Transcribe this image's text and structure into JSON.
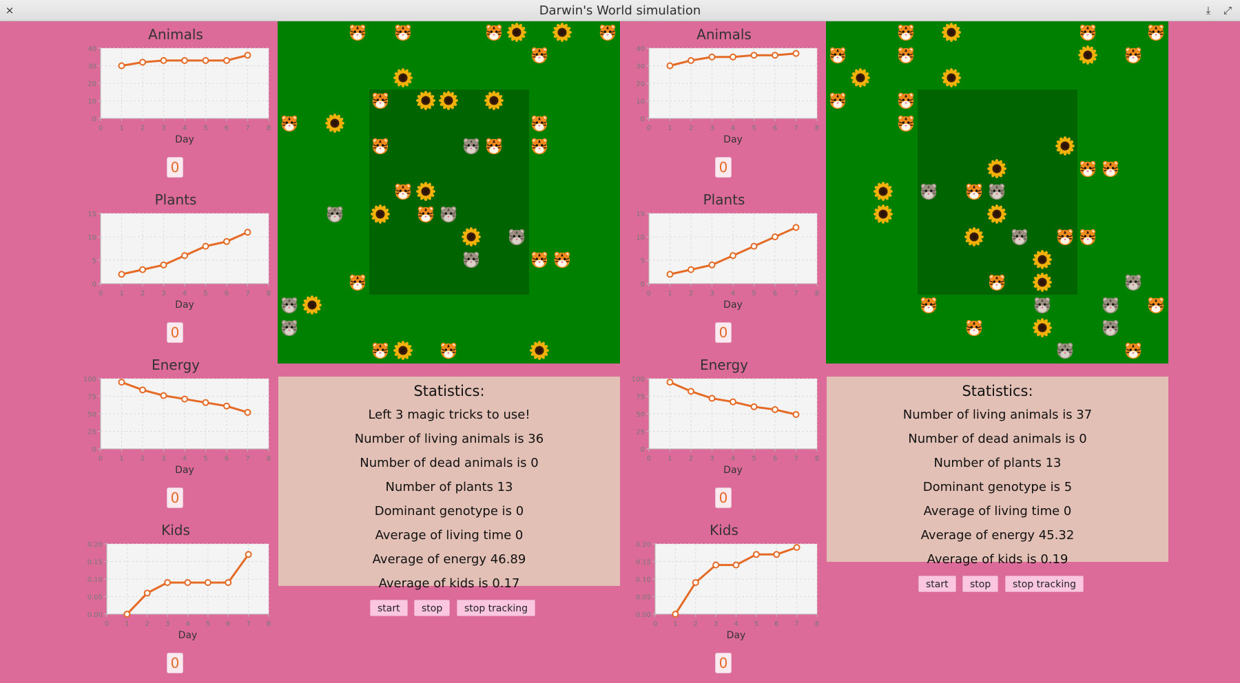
{
  "window": {
    "title": "Darwin's World simulation",
    "close_glyph": "×",
    "minimize_glyph": "⤓",
    "maximize_glyph": "⤢"
  },
  "colors": {
    "background": "#dd6b99",
    "steppe": "#008000",
    "jungle": "#006400",
    "stats_bg": "#e2c0b6",
    "line": "#e46a25",
    "button_bg": "#fbc6e0"
  },
  "icons": {
    "animal": "tiger-icon",
    "weak_animal": "grey-tiger-icon",
    "plant": "sunflower-icon"
  },
  "sim1": {
    "charts": [
      {
        "title": "Animals",
        "xlabel": "Day",
        "counter": "0"
      },
      {
        "title": "Plants",
        "xlabel": "Day",
        "counter": "0"
      },
      {
        "title": "Energy",
        "xlabel": "Day",
        "counter": "0"
      },
      {
        "title": "Kids",
        "xlabel": "Day",
        "counter": "0"
      }
    ],
    "map": {
      "cells": [
        {
          "r": 0,
          "c": 3,
          "t": "A"
        },
        {
          "r": 0,
          "c": 5,
          "t": "A"
        },
        {
          "r": 0,
          "c": 9,
          "t": "A"
        },
        {
          "r": 0,
          "c": 10,
          "t": "P"
        },
        {
          "r": 0,
          "c": 12,
          "t": "P"
        },
        {
          "r": 0,
          "c": 14,
          "t": "A"
        },
        {
          "r": 1,
          "c": 11,
          "t": "A"
        },
        {
          "r": 2,
          "c": 5,
          "t": "P"
        },
        {
          "r": 3,
          "c": 4,
          "t": "A"
        },
        {
          "r": 3,
          "c": 6,
          "t": "P"
        },
        {
          "r": 3,
          "c": 7,
          "t": "P"
        },
        {
          "r": 3,
          "c": 9,
          "t": "P"
        },
        {
          "r": 4,
          "c": 0,
          "t": "A"
        },
        {
          "r": 4,
          "c": 2,
          "t": "P"
        },
        {
          "r": 4,
          "c": 11,
          "t": "A"
        },
        {
          "r": 5,
          "c": 4,
          "t": "A"
        },
        {
          "r": 5,
          "c": 8,
          "t": "W"
        },
        {
          "r": 5,
          "c": 9,
          "t": "A"
        },
        {
          "r": 5,
          "c": 11,
          "t": "A"
        },
        {
          "r": 7,
          "c": 5,
          "t": "A"
        },
        {
          "r": 7,
          "c": 6,
          "t": "P"
        },
        {
          "r": 8,
          "c": 2,
          "t": "W"
        },
        {
          "r": 8,
          "c": 4,
          "t": "P"
        },
        {
          "r": 8,
          "c": 6,
          "t": "A"
        },
        {
          "r": 8,
          "c": 7,
          "t": "W"
        },
        {
          "r": 9,
          "c": 8,
          "t": "P"
        },
        {
          "r": 9,
          "c": 10,
          "t": "W"
        },
        {
          "r": 10,
          "c": 8,
          "t": "W"
        },
        {
          "r": 10,
          "c": 11,
          "t": "A"
        },
        {
          "r": 10,
          "c": 12,
          "t": "A"
        },
        {
          "r": 11,
          "c": 3,
          "t": "A"
        },
        {
          "r": 12,
          "c": 0,
          "t": "W"
        },
        {
          "r": 12,
          "c": 1,
          "t": "P"
        },
        {
          "r": 13,
          "c": 0,
          "t": "W"
        },
        {
          "r": 14,
          "c": 4,
          "t": "A"
        },
        {
          "r": 14,
          "c": 5,
          "t": "P"
        },
        {
          "r": 14,
          "c": 7,
          "t": "A"
        },
        {
          "r": 14,
          "c": 11,
          "t": "P"
        }
      ]
    },
    "stats": {
      "heading": "Statistics:",
      "lines": [
        "Left 3 magic tricks to use!",
        "Number of living animals is 36",
        "Number of dead animals is 0",
        "Number of plants 13",
        "Dominant genotype is 0",
        "Average of living time 0",
        "Average of energy 46.89",
        "Average of kids is 0.17"
      ]
    },
    "buttons": {
      "start": "start",
      "stop": "stop",
      "track": "stop tracking"
    }
  },
  "sim2": {
    "charts": [
      {
        "title": "Animals",
        "xlabel": "Day",
        "counter": "0"
      },
      {
        "title": "Plants",
        "xlabel": "Day",
        "counter": "0"
      },
      {
        "title": "Energy",
        "xlabel": "Day",
        "counter": "0"
      },
      {
        "title": "Kids",
        "xlabel": "Day",
        "counter": "0"
      }
    ],
    "map": {
      "cells": [
        {
          "r": 0,
          "c": 3,
          "t": "A"
        },
        {
          "r": 0,
          "c": 5,
          "t": "P"
        },
        {
          "r": 0,
          "c": 11,
          "t": "A"
        },
        {
          "r": 0,
          "c": 14,
          "t": "A"
        },
        {
          "r": 1,
          "c": 0,
          "t": "A"
        },
        {
          "r": 1,
          "c": 3,
          "t": "A"
        },
        {
          "r": 1,
          "c": 11,
          "t": "P"
        },
        {
          "r": 1,
          "c": 13,
          "t": "A"
        },
        {
          "r": 2,
          "c": 1,
          "t": "P"
        },
        {
          "r": 2,
          "c": 5,
          "t": "P"
        },
        {
          "r": 3,
          "c": 0,
          "t": "A"
        },
        {
          "r": 3,
          "c": 3,
          "t": "A"
        },
        {
          "r": 4,
          "c": 3,
          "t": "A"
        },
        {
          "r": 5,
          "c": 10,
          "t": "P"
        },
        {
          "r": 6,
          "c": 7,
          "t": "P"
        },
        {
          "r": 6,
          "c": 11,
          "t": "A"
        },
        {
          "r": 6,
          "c": 12,
          "t": "A"
        },
        {
          "r": 7,
          "c": 2,
          "t": "P"
        },
        {
          "r": 7,
          "c": 4,
          "t": "W"
        },
        {
          "r": 7,
          "c": 6,
          "t": "A"
        },
        {
          "r": 7,
          "c": 7,
          "t": "W"
        },
        {
          "r": 8,
          "c": 2,
          "t": "P"
        },
        {
          "r": 8,
          "c": 7,
          "t": "P"
        },
        {
          "r": 9,
          "c": 6,
          "t": "P"
        },
        {
          "r": 9,
          "c": 8,
          "t": "W"
        },
        {
          "r": 9,
          "c": 10,
          "t": "A"
        },
        {
          "r": 9,
          "c": 11,
          "t": "A"
        },
        {
          "r": 10,
          "c": 9,
          "t": "P"
        },
        {
          "r": 11,
          "c": 7,
          "t": "A"
        },
        {
          "r": 11,
          "c": 9,
          "t": "P"
        },
        {
          "r": 11,
          "c": 13,
          "t": "W"
        },
        {
          "r": 12,
          "c": 4,
          "t": "A"
        },
        {
          "r": 12,
          "c": 9,
          "t": "W"
        },
        {
          "r": 12,
          "c": 12,
          "t": "W"
        },
        {
          "r": 12,
          "c": 14,
          "t": "A"
        },
        {
          "r": 13,
          "c": 6,
          "t": "A"
        },
        {
          "r": 13,
          "c": 9,
          "t": "P"
        },
        {
          "r": 13,
          "c": 12,
          "t": "W"
        },
        {
          "r": 14,
          "c": 10,
          "t": "W"
        },
        {
          "r": 14,
          "c": 13,
          "t": "A"
        }
      ]
    },
    "stats": {
      "heading": "Statistics:",
      "lines": [
        "Number of living animals is 37",
        "Number of dead animals is 0",
        "Number of plants 13",
        "Dominant genotype is 5",
        "Average of living time 0",
        "Average of energy 45.32",
        "Average of kids is 0.19"
      ]
    },
    "buttons": {
      "start": "start",
      "stop": "stop",
      "track": "stop tracking"
    }
  },
  "chart_data": [
    {
      "type": "line",
      "title": "Animals",
      "xlabel": "Day",
      "ylabel": "",
      "x": [
        1,
        2,
        3,
        4,
        5,
        6,
        7
      ],
      "values": [
        30,
        32,
        33,
        33,
        33,
        33,
        36
      ],
      "xlim": [
        0,
        8
      ],
      "ylim": [
        0,
        40
      ],
      "yticks": [
        0,
        10,
        20,
        30,
        40
      ],
      "yticklabels": [
        "0",
        "10",
        "20",
        "30",
        "40"
      ]
    },
    {
      "type": "line",
      "title": "Plants",
      "xlabel": "Day",
      "ylabel": "",
      "x": [
        1,
        2,
        3,
        4,
        5,
        6,
        7
      ],
      "values": [
        2,
        3,
        4,
        6,
        8,
        9,
        11
      ],
      "xlim": [
        0,
        8
      ],
      "ylim": [
        0,
        15
      ],
      "yticks": [
        0,
        5,
        10,
        15
      ],
      "yticklabels": [
        "0",
        "5",
        "10",
        "15"
      ]
    },
    {
      "type": "line",
      "title": "Energy",
      "xlabel": "Day",
      "ylabel": "",
      "x": [
        1,
        2,
        3,
        4,
        5,
        6,
        7
      ],
      "values": [
        95,
        84,
        76,
        71,
        66,
        61,
        52
      ],
      "xlim": [
        0,
        8
      ],
      "ylim": [
        0,
        100
      ],
      "yticks": [
        0,
        25,
        50,
        75,
        100
      ],
      "yticklabels": [
        "0",
        "25",
        "50",
        "75",
        "100"
      ]
    },
    {
      "type": "line",
      "title": "Kids",
      "xlabel": "Day",
      "ylabel": "",
      "x": [
        1,
        2,
        3,
        4,
        5,
        6,
        7
      ],
      "values": [
        0,
        0.06,
        0.09,
        0.09,
        0.09,
        0.09,
        0.17
      ],
      "xlim": [
        0,
        8
      ],
      "ylim": [
        0,
        0.2
      ],
      "yticks": [
        0,
        0.05,
        0.1,
        0.15,
        0.2
      ],
      "yticklabels": [
        "0.00",
        "0.05",
        "0.10",
        "0.15",
        "0.20"
      ]
    },
    {
      "type": "line",
      "title": "Animals",
      "xlabel": "Day",
      "ylabel": "",
      "x": [
        1,
        2,
        3,
        4,
        5,
        6,
        7
      ],
      "values": [
        30,
        33,
        35,
        35,
        36,
        36,
        37
      ],
      "xlim": [
        0,
        8
      ],
      "ylim": [
        0,
        40
      ],
      "yticks": [
        0,
        10,
        20,
        30,
        40
      ],
      "yticklabels": [
        "0",
        "10",
        "20",
        "30",
        "40"
      ]
    },
    {
      "type": "line",
      "title": "Plants",
      "xlabel": "Day",
      "ylabel": "",
      "x": [
        1,
        2,
        3,
        4,
        5,
        6,
        7
      ],
      "values": [
        2,
        3,
        4,
        6,
        8,
        10,
        12
      ],
      "xlim": [
        0,
        8
      ],
      "ylim": [
        0,
        15
      ],
      "yticks": [
        0,
        5,
        10,
        15
      ],
      "yticklabels": [
        "0",
        "5",
        "10",
        "15"
      ]
    },
    {
      "type": "line",
      "title": "Energy",
      "xlabel": "Day",
      "ylabel": "",
      "x": [
        1,
        2,
        3,
        4,
        5,
        6,
        7
      ],
      "values": [
        95,
        82,
        72,
        67,
        60,
        56,
        49
      ],
      "xlim": [
        0,
        8
      ],
      "ylim": [
        0,
        100
      ],
      "yticks": [
        0,
        25,
        50,
        75,
        100
      ],
      "yticklabels": [
        "0",
        "25",
        "50",
        "75",
        "100"
      ]
    },
    {
      "type": "line",
      "title": "Kids",
      "xlabel": "Day",
      "ylabel": "",
      "x": [
        1,
        2,
        3,
        4,
        5,
        6,
        7
      ],
      "values": [
        0,
        0.09,
        0.14,
        0.14,
        0.17,
        0.17,
        0.19
      ],
      "xlim": [
        0,
        8
      ],
      "ylim": [
        0,
        0.2
      ],
      "yticks": [
        0,
        0.05,
        0.1,
        0.15,
        0.2
      ],
      "yticklabels": [
        "0.00",
        "0.05",
        "0.10",
        "0.15",
        "0.20"
      ]
    }
  ]
}
